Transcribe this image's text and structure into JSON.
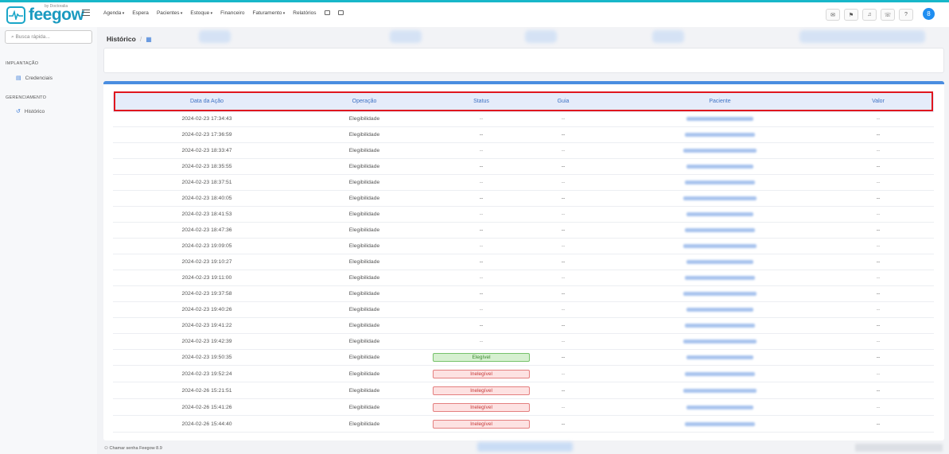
{
  "app": {
    "logo_text": "feegow",
    "logo_subtext": "by Doctoralia",
    "menu": [
      {
        "label": "Agenda",
        "caret": true
      },
      {
        "label": "Espera",
        "caret": false
      },
      {
        "label": "Pacientes",
        "caret": true
      },
      {
        "label": "Estoque",
        "caret": true
      },
      {
        "label": "Financeiro",
        "caret": false
      },
      {
        "label": "Faturamento",
        "caret": true
      },
      {
        "label": "Relatórios",
        "caret": false
      }
    ],
    "avatar_initial": "8"
  },
  "sidebar": {
    "search_placeholder": "Busca rápida...",
    "section_implantacao": "IMPLANTAÇÃO",
    "item_credenciais": "Credenciais",
    "section_gerenciamento": "GERENCIAMENTO",
    "item_historico": "Histórico"
  },
  "breadcrumb": {
    "title": "Histórico",
    "separator": "/"
  },
  "table": {
    "headers": {
      "data_acao": "Data da Ação",
      "operacao": "Operação",
      "status": "Status",
      "guia": "Guia",
      "paciente": "Paciente",
      "valor": "Valor"
    },
    "rows": [
      {
        "date": "2024-02-23 17:34:43",
        "op": "Elegibilidade",
        "status": "--",
        "guia": "--",
        "valor": "--"
      },
      {
        "date": "2024-02-23 17:36:59",
        "op": "Elegibilidade",
        "status": "--",
        "guia": "--",
        "valor": "--"
      },
      {
        "date": "2024-02-23 18:33:47",
        "op": "Elegibilidade",
        "status": "--",
        "guia": "--",
        "valor": "--"
      },
      {
        "date": "2024-02-23 18:35:55",
        "op": "Elegibilidade",
        "status": "--",
        "guia": "--",
        "valor": "--"
      },
      {
        "date": "2024-02-23 18:37:51",
        "op": "Elegibilidade",
        "status": "--",
        "guia": "--",
        "valor": "--"
      },
      {
        "date": "2024-02-23 18:40:05",
        "op": "Elegibilidade",
        "status": "--",
        "guia": "--",
        "valor": "--"
      },
      {
        "date": "2024-02-23 18:41:53",
        "op": "Elegibilidade",
        "status": "--",
        "guia": "--",
        "valor": "--"
      },
      {
        "date": "2024-02-23 18:47:36",
        "op": "Elegibilidade",
        "status": "--",
        "guia": "--",
        "valor": "--"
      },
      {
        "date": "2024-02-23 19:09:05",
        "op": "Elegibilidade",
        "status": "--",
        "guia": "--",
        "valor": "--"
      },
      {
        "date": "2024-02-23 19:10:27",
        "op": "Elegibilidade",
        "status": "--",
        "guia": "--",
        "valor": "--"
      },
      {
        "date": "2024-02-23 19:11:00",
        "op": "Elegibilidade",
        "status": "--",
        "guia": "--",
        "valor": "--"
      },
      {
        "date": "2024-02-23 19:37:58",
        "op": "Elegibilidade",
        "status": "--",
        "guia": "--",
        "valor": "--"
      },
      {
        "date": "2024-02-23 19:40:26",
        "op": "Elegibilidade",
        "status": "--",
        "guia": "--",
        "valor": "--"
      },
      {
        "date": "2024-02-23 19:41:22",
        "op": "Elegibilidade",
        "status": "--",
        "guia": "--",
        "valor": "--"
      },
      {
        "date": "2024-02-23 19:42:39",
        "op": "Elegibilidade",
        "status": "--",
        "guia": "--",
        "valor": "--"
      },
      {
        "date": "2024-02-23 19:50:35",
        "op": "Elegibilidade",
        "status": "Elegível",
        "status_kind": "ok",
        "guia": "--",
        "valor": "--"
      },
      {
        "date": "2024-02-23 19:52:24",
        "op": "Elegibilidade",
        "status": "Inelegível",
        "status_kind": "bad",
        "guia": "--",
        "valor": "--"
      },
      {
        "date": "2024-02-26 15:21:51",
        "op": "Elegibilidade",
        "status": "Inelegível",
        "status_kind": "bad",
        "guia": "--",
        "valor": "--"
      },
      {
        "date": "2024-02-26 15:41:26",
        "op": "Elegibilidade",
        "status": "Inelegível",
        "status_kind": "bad",
        "guia": "--",
        "valor": "--"
      },
      {
        "date": "2024-02-26 15:44:40",
        "op": "Elegibilidade",
        "status": "Inelegível",
        "status_kind": "bad",
        "guia": "--",
        "valor": "--"
      }
    ]
  },
  "footer": {
    "left_text": "Chamar senha Feegow 8.9"
  },
  "colors": {
    "accent": "#4a8de0",
    "topbar_border": "#18b7c9",
    "highlight": "#e0161e"
  }
}
